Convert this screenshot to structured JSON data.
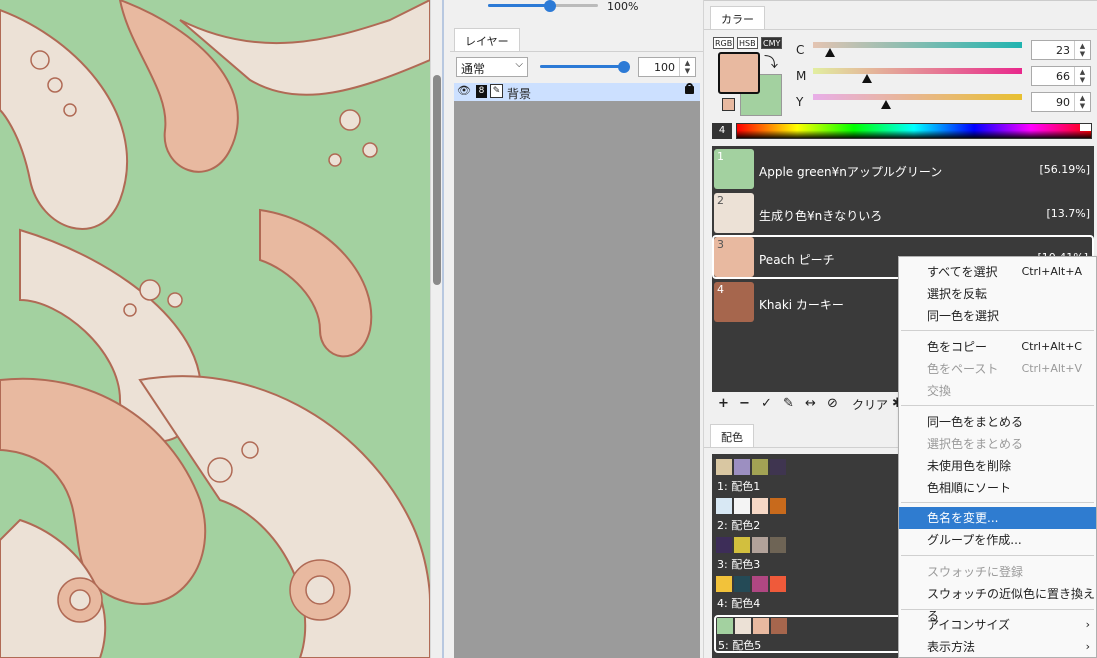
{
  "layer_panel": {
    "top_opacity_label": "100%",
    "tab_label": "レイヤー",
    "blend_mode": "通常",
    "opacity_value": "100",
    "layer_bit_badge": "8",
    "layer_name": "背景"
  },
  "color_panel": {
    "tab_label": "カラー",
    "modes": [
      "RGB",
      "HSB",
      "CMY"
    ],
    "foreground_color": "#e8b9a0",
    "background_color": "#a3d1a0",
    "cmy": [
      {
        "label": "C",
        "value": "23",
        "level": 0.08
      },
      {
        "label": "M",
        "value": "66",
        "level": 0.26
      },
      {
        "label": "Y",
        "value": "90",
        "level": 0.35
      }
    ],
    "spectrum_badge": "4"
  },
  "swatches": [
    {
      "num": "1",
      "name": "Apple green¥nアップルグリーン",
      "pct": "[56.19%]",
      "color": "#a3d1a0"
    },
    {
      "num": "2",
      "name": "生成り色¥nきなりいろ",
      "pct": "[13.7%]",
      "color": "#ece1d6"
    },
    {
      "num": "3",
      "name": "Peach ピーチ",
      "pct": "[10.41%]",
      "color": "#e8b9a0"
    },
    {
      "num": "4",
      "name": "Khaki カーキー",
      "pct": "",
      "color": "#a6664d"
    }
  ],
  "swatch_toolbar": {
    "clear_label": "クリア"
  },
  "scheme_panel": {
    "tab_label": "配色",
    "schemes": [
      {
        "label": "1: 配色1",
        "colors": [
          "#d9c7a2",
          "#9c8fc1",
          "#a2a354",
          "#3f3550"
        ]
      },
      {
        "label": "2: 配色2",
        "colors": [
          "#d8e8f4",
          "#f4f4f4",
          "#f6d8c6",
          "#c86a1c"
        ]
      },
      {
        "label": "3: 配色3",
        "colors": [
          "#3d2d58",
          "#d2bf3e",
          "#b2a29a",
          "#6e6455"
        ]
      },
      {
        "label": "4: 配色4",
        "colors": [
          "#f2c23a",
          "#244a56",
          "#b04782",
          "#ef5a3a"
        ]
      },
      {
        "label": "5: 配色5",
        "colors": [
          "#a3d1a0",
          "#ece1d6",
          "#e8b9a0",
          "#a6664d"
        ]
      }
    ]
  },
  "context_menu": {
    "items": [
      {
        "label": "すべてを選択",
        "shortcut": "Ctrl+Alt+A",
        "disabled": false
      },
      {
        "label": "選択を反転",
        "shortcut": "",
        "disabled": false
      },
      {
        "label": "同一色を選択",
        "shortcut": "",
        "disabled": false
      },
      {
        "label": "色をコピー",
        "shortcut": "Ctrl+Alt+C",
        "disabled": false
      },
      {
        "label": "色をペースト",
        "shortcut": "Ctrl+Alt+V",
        "disabled": true
      },
      {
        "label": "交換",
        "shortcut": "",
        "disabled": true
      },
      {
        "label": "同一色をまとめる",
        "shortcut": "",
        "disabled": false
      },
      {
        "label": "選択色をまとめる",
        "shortcut": "",
        "disabled": true
      },
      {
        "label": "未使用色を削除",
        "shortcut": "",
        "disabled": false
      },
      {
        "label": "色相順にソート",
        "shortcut": "",
        "disabled": false
      },
      {
        "label": "色名を変更...",
        "shortcut": "",
        "disabled": false
      },
      {
        "label": "グループを作成...",
        "shortcut": "",
        "disabled": false
      },
      {
        "label": "スウォッチに登録",
        "shortcut": "",
        "disabled": true
      },
      {
        "label": "スウォッチの近似色に置き換える",
        "shortcut": "",
        "disabled": false
      },
      {
        "label": "アイコンサイズ",
        "shortcut": "",
        "disabled": false
      },
      {
        "label": "表示方法",
        "shortcut": "",
        "disabled": false
      }
    ]
  }
}
